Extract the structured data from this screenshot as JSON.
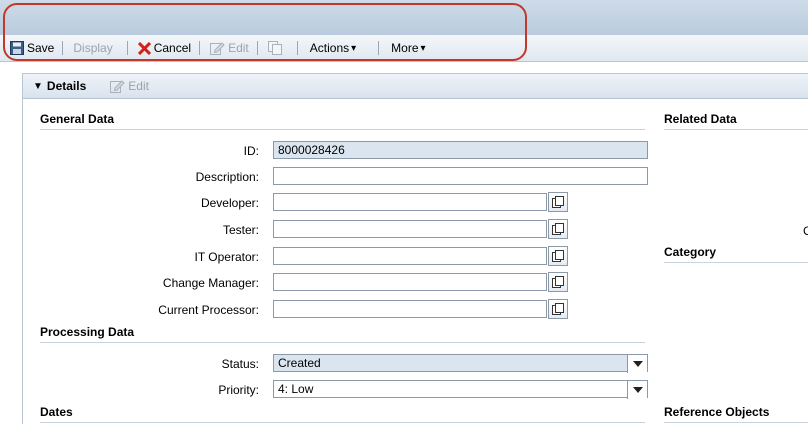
{
  "toolbar": {
    "save": "Save",
    "display": "Display",
    "cancel": "Cancel",
    "edit": "Edit",
    "actions": "Actions",
    "more": "More",
    "dropdown_glyph": "▾"
  },
  "panel": {
    "title": "Details",
    "edit": "Edit"
  },
  "sections": {
    "general": "General Data",
    "processing": "Processing Data",
    "dates": "Dates",
    "related": "Related Data",
    "category": "Category",
    "reference": "Reference Objects"
  },
  "general_fields": [
    {
      "label": "ID:",
      "value": "8000028426"
    },
    {
      "label": "Description:",
      "value": ""
    },
    {
      "label": "Developer:",
      "value": ""
    },
    {
      "label": "Tester:",
      "value": ""
    },
    {
      "label": "IT Operator:",
      "value": ""
    },
    {
      "label": "Change Manager:",
      "value": ""
    },
    {
      "label": "Current Processor:",
      "value": ""
    }
  ],
  "processing_fields": [
    {
      "label": "Status:",
      "value": "Created"
    },
    {
      "label": "Priority:",
      "value": "4: Low"
    }
  ],
  "cut_text": "C",
  "colors": {
    "highlight": "#c0392b",
    "readonly_field": "#dbe5ef"
  }
}
